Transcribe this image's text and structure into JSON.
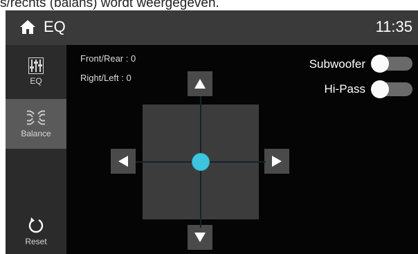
{
  "caption": "s/rechts (balans) wordt weergegeven.",
  "header": {
    "title": "EQ",
    "time": "11:35",
    "home_icon": "home-icon"
  },
  "sidebar": {
    "items": [
      {
        "label": "EQ",
        "icon": "eq-sliders-icon"
      },
      {
        "label": "Balance",
        "icon": "balance-icon",
        "active": true
      },
      {
        "label": "Reset",
        "icon": "reset-icon"
      }
    ]
  },
  "balance": {
    "front_rear": "Front/Rear : 0",
    "right_left": "Right/Left : 0",
    "front_rear_value": 0,
    "right_left_value": 0
  },
  "toggles": {
    "subwoofer": {
      "label": "Subwoofer",
      "on": false
    },
    "hi_pass": {
      "label": "Hi-Pass",
      "on": false
    }
  },
  "colors": {
    "accent": "#3fc4e0",
    "header_bg": "#3a3a3a",
    "sidebar_bg": "#2b2b2b",
    "active_bg": "#5a5a5a"
  }
}
